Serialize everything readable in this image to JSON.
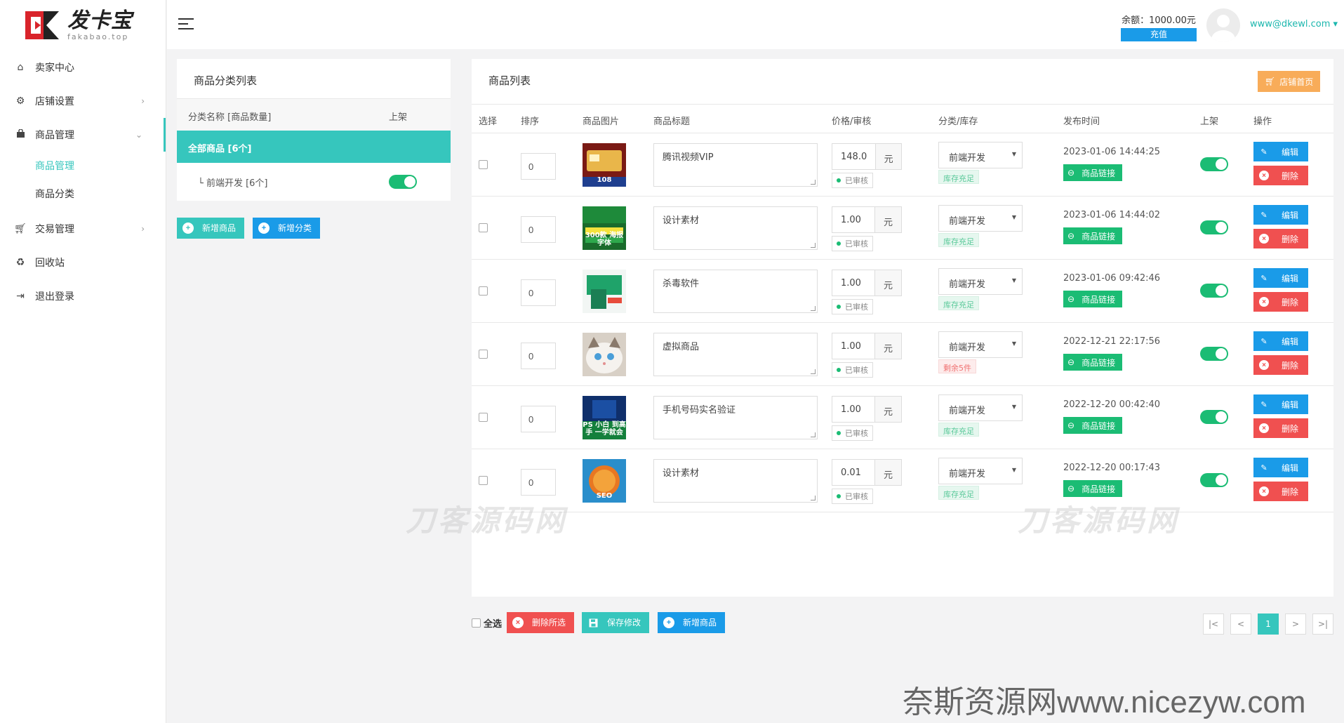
{
  "brand": {
    "name": "发卡宝",
    "sub": "fakabao.top"
  },
  "sidebar": {
    "items": [
      {
        "label": "卖家中心",
        "icon": "home-icon"
      },
      {
        "label": "店铺设置",
        "icon": "gear-icon"
      },
      {
        "label": "商品管理",
        "icon": "bag-icon"
      },
      {
        "label": "交易管理",
        "icon": "cart-icon"
      },
      {
        "label": "回收站",
        "icon": "recycle-icon"
      },
      {
        "label": "退出登录",
        "icon": "logout-icon"
      }
    ],
    "sub_items": [
      {
        "label": "商品管理"
      },
      {
        "label": "商品分类"
      }
    ]
  },
  "header": {
    "balance_label": "余额：1000.00元",
    "recharge_label": "充值",
    "user": "www@dkewl.com ▾"
  },
  "category_panel": {
    "title": "商品分类列表",
    "col_name": "分类名称 [商品数量]",
    "col_shelf": "上架",
    "all_label": "全部商品 [6个]",
    "rows": [
      {
        "name": "└ 前端开发 [6个]",
        "on": true
      }
    ],
    "add_product": "新增商品",
    "add_category": "新增分类"
  },
  "product_panel": {
    "title": "商品列表",
    "shop_btn": "店铺首页",
    "columns": [
      "选择",
      "排序",
      "商品图片",
      "商品标题",
      "价格/审核",
      "分类/库存",
      "发布时间",
      "上架",
      "操作"
    ],
    "link_label": "商品链接",
    "edit_label": "编辑",
    "delete_label": "删除",
    "price_unit": "元",
    "rows": [
      {
        "sort": "0",
        "title": "腾讯视频VIP",
        "price": "148.0",
        "audit": "已审核",
        "category": "前端开发",
        "stock": "库存充足",
        "stock_warn": false,
        "time": "2023-01-06 14:44:25",
        "img": "vip",
        "img_text": "108"
      },
      {
        "sort": "0",
        "title": "设计素材",
        "price": "1.00",
        "audit": "已审核",
        "category": "前端开发",
        "stock": "库存充足",
        "stock_warn": false,
        "time": "2023-01-06 14:44:02",
        "img": "font",
        "img_text": "300款 海报字体"
      },
      {
        "sort": "0",
        "title": "杀毒软件",
        "price": "1.00",
        "audit": "已审核",
        "category": "前端开发",
        "stock": "库存充足",
        "stock_warn": false,
        "time": "2023-01-06 09:42:46",
        "img": "soft",
        "img_text": ""
      },
      {
        "sort": "0",
        "title": "虚拟商品",
        "price": "1.00",
        "audit": "已审核",
        "category": "前端开发",
        "stock": "剩余5件",
        "stock_warn": true,
        "time": "2022-12-21 22:17:56",
        "img": "cat",
        "img_text": ""
      },
      {
        "sort": "0",
        "title": "手机号码实名验证",
        "price": "1.00",
        "audit": "已审核",
        "category": "前端开发",
        "stock": "库存充足",
        "stock_warn": false,
        "time": "2022-12-20 00:42:40",
        "img": "ps",
        "img_text": "PS 小白 到高手 一学就会"
      },
      {
        "sort": "0",
        "title": "设计素材",
        "price": "0.01",
        "audit": "已审核",
        "category": "前端开发",
        "stock": "库存充足",
        "stock_warn": false,
        "time": "2022-12-20 00:17:43",
        "img": "seo",
        "img_text": "SEO"
      }
    ]
  },
  "footer": {
    "select_all": "全选",
    "delete_selected": "删除所选",
    "save_changes": "保存修改",
    "add_product": "新增商品",
    "pager": [
      "|<",
      "<",
      "1",
      ">",
      ">|"
    ],
    "current_page": "1"
  },
  "watermarks": [
    "刀客源码网",
    "刀客源码网"
  ],
  "site_watermark": "奈斯资源网www.nicezyw.com",
  "colors": {
    "accent": "#36c6bd",
    "blue": "#1a9be8",
    "red": "#f05050",
    "green": "#1bbc74",
    "orange": "#f8ac59"
  }
}
